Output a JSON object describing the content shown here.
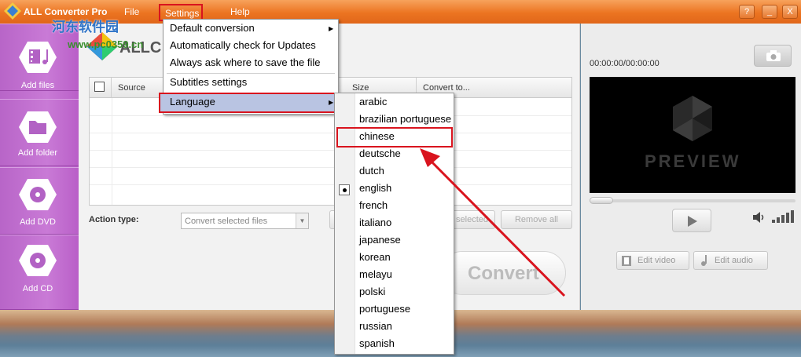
{
  "title_bar": {
    "app_title": "ALL Converter Pro",
    "menu": [
      "File",
      "Settings",
      "Help"
    ],
    "window_buttons": {
      "help": "?",
      "minimize": "_",
      "close": "X"
    },
    "watermark": "河东软件园",
    "watermark_url": "www.pc0359.cn"
  },
  "sidebar": {
    "items": [
      {
        "label": "Add files",
        "icon": "film-music-icon"
      },
      {
        "label": "Add folder",
        "icon": "folder-icon"
      },
      {
        "label": "Add DVD",
        "icon": "dvd-disc-icon"
      },
      {
        "label": "Add CD",
        "icon": "cd-disc-icon"
      }
    ]
  },
  "main": {
    "logo_text": "ALLC",
    "table": {
      "columns": [
        "Source",
        "Size",
        "Convert to..."
      ],
      "rows": []
    },
    "action_label": "Action type:",
    "action_select": "Convert selected files",
    "buttons": {
      "remove_selected": "selected",
      "remove_all": "Remove all"
    },
    "convert_label": "Convert"
  },
  "preview_panel": {
    "time": "00:00:00/00:00:00",
    "preview_text": "PREVIEW",
    "edit_video": "Edit video",
    "edit_audio": "Edit audio"
  },
  "settings_menu": {
    "items": [
      "Default conversion",
      "Automatically check for Updates",
      "Always ask where to save the file",
      "Subtitles settings",
      "Language"
    ]
  },
  "language_menu": {
    "selected": "english",
    "highlighted": "chinese",
    "items": [
      "arabic",
      "brazilian portuguese",
      "chinese",
      "deutsche",
      "dutch",
      "english",
      "french",
      "italiano",
      "japanese",
      "korean",
      "melayu",
      "polski",
      "portuguese",
      "russian",
      "spanish"
    ]
  },
  "colors": {
    "titlebar": "#ec7421",
    "sidebar": "#c97ad6",
    "highlight_box": "#d9141e",
    "arrow": "#d9141e"
  }
}
